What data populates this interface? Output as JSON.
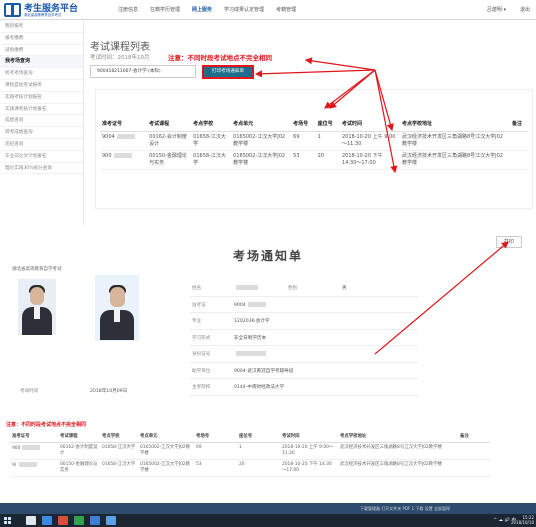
{
  "app": {
    "logo_title": "考生服务平台",
    "logo_sub": "湖北省高等教育自学考试",
    "nav": [
      "注册信息",
      "在籍学历管理",
      "网上服务",
      "学习成果认定管理",
      "考籍管理"
    ],
    "active_nav_index": 2,
    "user": "吕建明 ▾",
    "logout": "退出"
  },
  "sidebar": {
    "items": [
      "我的报考",
      "报考缴费",
      "减免缴费",
      "我考场查询",
      "机考考场查询",
      "课程自动考试报考",
      "实践考核计划报名",
      "实践课考核计划报名",
      "成绩查询",
      "转考成绩查询",
      "违纪查询",
      "毕业前论文计划报名",
      "理论实践30%统分查询"
    ],
    "active_index": 3
  },
  "main": {
    "title": "考试课程列表",
    "exam_time": "考试时间：2018年10月",
    "notice": "注意：不同时段考试地点不完全相同",
    "select_value": "900418211067-会计学-(本科)",
    "print_button": "打印考场通知单",
    "columns": [
      "准考证号",
      "考试课程",
      "考点学校",
      "考点单元",
      "考场号",
      "座位号",
      "考试时间",
      "考点学校地址",
      "备注"
    ],
    "rows": [
      {
        "id": "9004",
        "course": "00162-会计制度设计",
        "school": "01658-江汉大学",
        "unit": "0165002-江汉大学J02教学楼",
        "room": "69",
        "seat": "1",
        "time": "2018-10-20 上午 9:00～11:30",
        "addr": "武汉经济技术开发区三角湖路8号江汉大学J02教学楼",
        "note": ""
      },
      {
        "id": "900",
        "course": "00150-金融理论与实务",
        "school": "01658-江汉大学",
        "unit": "0165002-江汉大学J02教学楼",
        "room": "53",
        "seat": "20",
        "time": "2018-10-20 下午 14:30～17:00",
        "addr": "武汉经济技术开发区三角湖路8号江汉大学J02教学楼",
        "note": ""
      }
    ]
  },
  "notice_card": {
    "title": "考场通知单",
    "print_button": "打印",
    "school_line": "湖北省高等教育自学考试",
    "info": {
      "name_label": "姓名",
      "gender_label": "性别",
      "gender_value": "男",
      "ticket_label": "准考证",
      "ticket_value": "9004",
      "major_label": "专业",
      "major_value": "120203K-会计学",
      "form_label": "学习形式",
      "form_value": "非全日制学历本",
      "idcard_label": "身份证号",
      "exam_unit_label": "助学单位",
      "exam_unit_value": "9004-武汉黄冠自学考辅导班",
      "host_label": "主考院校",
      "host_value": "0144-中南财经政法大学"
    },
    "exam_date_label": "考试时间",
    "exam_date_value": "2018年10月09日",
    "notice": "注意：不同时段考试地点不完全相同",
    "columns": [
      "准考证号",
      "考试课程",
      "考点学校",
      "考点单元",
      "考场号",
      "座位号",
      "考试时间",
      "考点学校地址",
      "备注"
    ],
    "rows": [
      {
        "id": "900",
        "course": "00162-会计制度设计",
        "school": "01658-江汉大学",
        "unit": "0165002-江汉大学J02教学楼",
        "room": "69",
        "seat": "1",
        "time": "2018-10-20 上午 9:00～11:30",
        "addr": "武汉经济技术开发区三角湖路8号江汉大学J02教学楼",
        "note": ""
      },
      {
        "id": "9(",
        "course": "00150-金融理论与实务",
        "school": "01658-江汉大学",
        "unit": "0165002-江汉大学J02教学楼",
        "room": "53",
        "seat": "20",
        "time": "2018-10-20 下午 14:30～17:00",
        "addr": "武汉经济技术开发区三角湖路8号江汉大学J02教学楼",
        "note": ""
      }
    ]
  },
  "download_bar": {
    "text": "下载管理器   打开文件夹   PDF   1   下载   设置   全部暂停"
  },
  "taskbar": {
    "tray": "^  ☁  🔊  中",
    "time": "15:22",
    "date": "2018/10/10"
  },
  "colors": {
    "brand_blue": "#1a5aa8",
    "notice_red": "#e0161b",
    "print_btn": "#1c6e8c",
    "taskbar": "#1c2633"
  }
}
